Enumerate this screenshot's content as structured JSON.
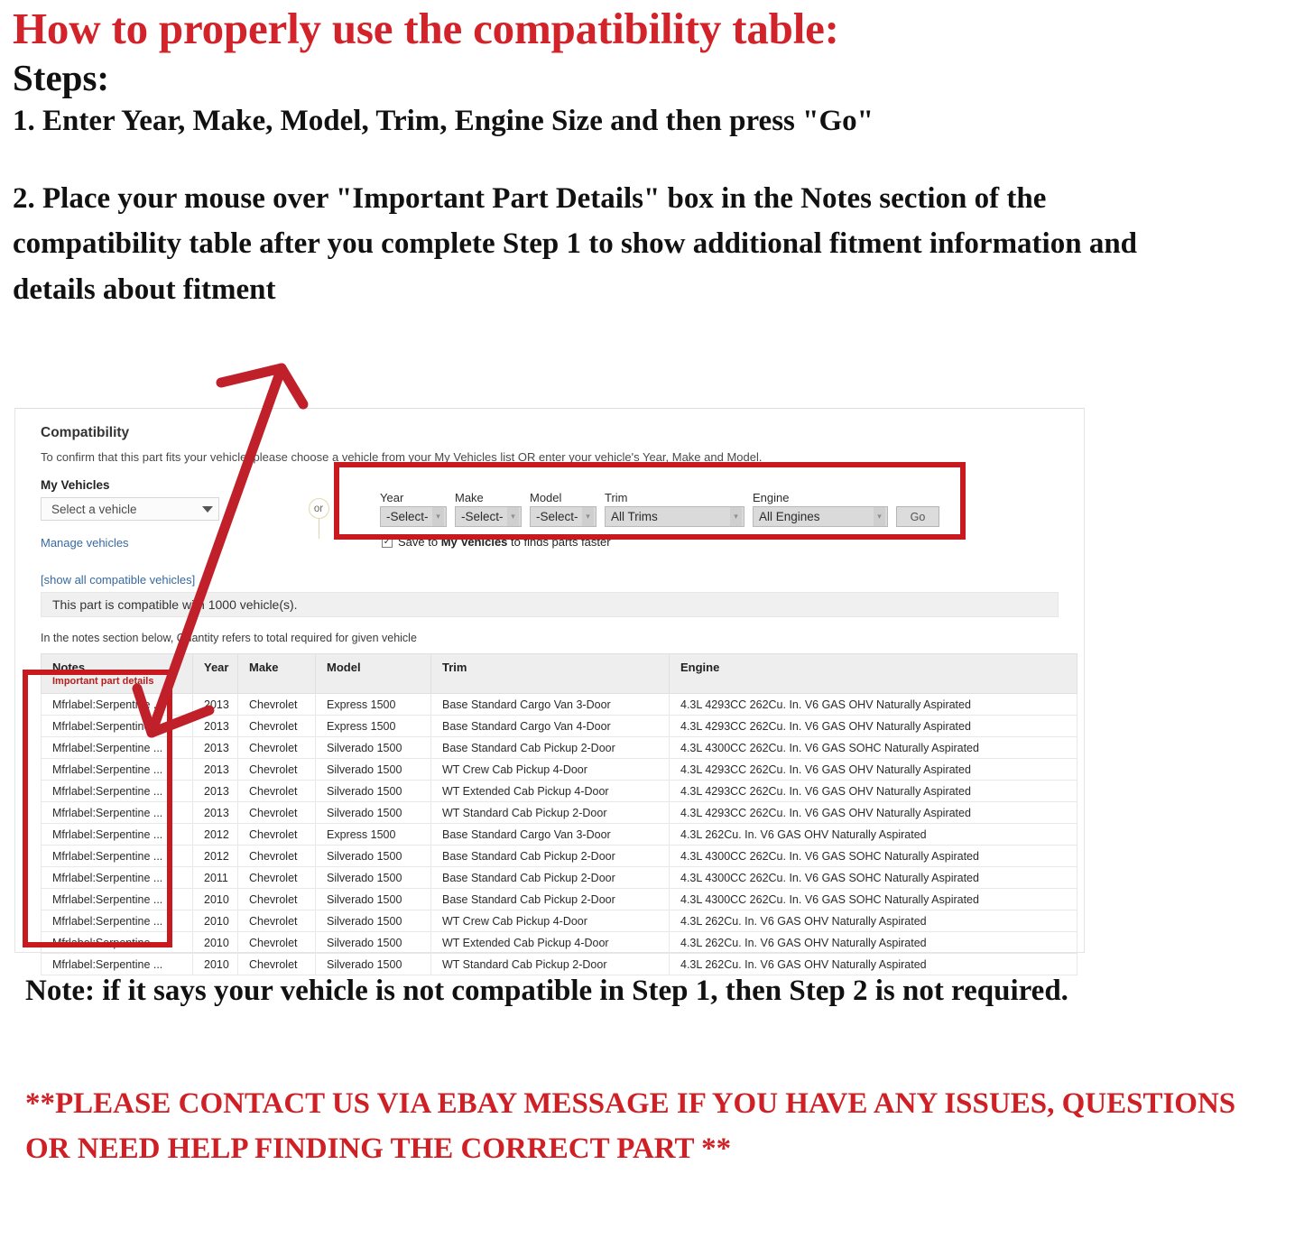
{
  "headings": {
    "title": "How to properly use the compatibility table:",
    "steps_label": "Steps:",
    "step1": "1. Enter Year, Make, Model, Trim, Engine Size and then press \"Go\"",
    "step2": "2. Place your mouse over \"Important Part Details\" box in the Notes section of the compatibility table after you complete Step 1 to show additional fitment information and details about fitment"
  },
  "footer": {
    "note": "Note: if it says your vehicle is not compatible in Step 1, then Step 2 is not required.",
    "contact": "**PLEASE CONTACT US VIA EBAY MESSAGE IF YOU HAVE ANY ISSUES, QUESTIONS OR NEED HELP FINDING THE CORRECT PART **"
  },
  "compatibility": {
    "title": "Compatibility",
    "subtitle": "To confirm that this part fits your vehicle, please choose a vehicle from your My Vehicles list OR enter your vehicle's Year, Make and Model.",
    "my_vehicles_label": "My Vehicles",
    "vehicle_select_value": "Select a vehicle",
    "manage_vehicles_link": "Manage vehicles",
    "show_all_link": "[show all compatible vehicles]",
    "or_label": "or",
    "banner": "This part is compatible with 1000 vehicle(s).",
    "qty_note": "In the notes section below, Quantity refers to total required for given vehicle",
    "fields": [
      {
        "label": "Year",
        "value": "-Select-"
      },
      {
        "label": "Make",
        "value": "-Select-"
      },
      {
        "label": "Model",
        "value": "-Select-"
      },
      {
        "label": "Trim",
        "value": "All Trims"
      },
      {
        "label": "Engine",
        "value": "All Engines"
      }
    ],
    "go_label": "Go",
    "save_checkbox_checked": true,
    "save_text_pre": "Save to ",
    "save_text_bold": "My Vehicles",
    "save_text_post": " to finds parts faster",
    "accent_red": "#c8191e",
    "link_blue": "#3769a0"
  },
  "table": {
    "columns": [
      "Notes",
      "Year",
      "Make",
      "Model",
      "Trim",
      "Engine"
    ],
    "notes_subheader": "Important part details",
    "rows": [
      {
        "notes": "Mfrlabel:Serpentine ...",
        "year": "2013",
        "make": "Chevrolet",
        "model": "Express 1500",
        "trim": "Base Standard Cargo Van 3-Door",
        "engine": "4.3L 4293CC 262Cu. In. V6 GAS OHV Naturally Aspirated"
      },
      {
        "notes": "Mfrlabel:Serpentine ...",
        "year": "2013",
        "make": "Chevrolet",
        "model": "Express 1500",
        "trim": "Base Standard Cargo Van 4-Door",
        "engine": "4.3L 4293CC 262Cu. In. V6 GAS OHV Naturally Aspirated"
      },
      {
        "notes": "Mfrlabel:Serpentine ...",
        "year": "2013",
        "make": "Chevrolet",
        "model": "Silverado 1500",
        "trim": "Base Standard Cab Pickup 2-Door",
        "engine": "4.3L 4300CC 262Cu. In. V6 GAS SOHC Naturally Aspirated"
      },
      {
        "notes": "Mfrlabel:Serpentine ...",
        "year": "2013",
        "make": "Chevrolet",
        "model": "Silverado 1500",
        "trim": "WT Crew Cab Pickup 4-Door",
        "engine": "4.3L 4293CC 262Cu. In. V6 GAS OHV Naturally Aspirated"
      },
      {
        "notes": "Mfrlabel:Serpentine ...",
        "year": "2013",
        "make": "Chevrolet",
        "model": "Silverado 1500",
        "trim": "WT Extended Cab Pickup 4-Door",
        "engine": "4.3L 4293CC 262Cu. In. V6 GAS OHV Naturally Aspirated"
      },
      {
        "notes": "Mfrlabel:Serpentine ...",
        "year": "2013",
        "make": "Chevrolet",
        "model": "Silverado 1500",
        "trim": "WT Standard Cab Pickup 2-Door",
        "engine": "4.3L 4293CC 262Cu. In. V6 GAS OHV Naturally Aspirated"
      },
      {
        "notes": "Mfrlabel:Serpentine ...",
        "year": "2012",
        "make": "Chevrolet",
        "model": "Express 1500",
        "trim": "Base Standard Cargo Van 3-Door",
        "engine": "4.3L 262Cu. In. V6 GAS OHV Naturally Aspirated"
      },
      {
        "notes": "Mfrlabel:Serpentine ...",
        "year": "2012",
        "make": "Chevrolet",
        "model": "Silverado 1500",
        "trim": "Base Standard Cab Pickup 2-Door",
        "engine": "4.3L 4300CC 262Cu. In. V6 GAS SOHC Naturally Aspirated"
      },
      {
        "notes": "Mfrlabel:Serpentine ...",
        "year": "2011",
        "make": "Chevrolet",
        "model": "Silverado 1500",
        "trim": "Base Standard Cab Pickup 2-Door",
        "engine": "4.3L 4300CC 262Cu. In. V6 GAS SOHC Naturally Aspirated"
      },
      {
        "notes": "Mfrlabel:Serpentine ...",
        "year": "2010",
        "make": "Chevrolet",
        "model": "Silverado 1500",
        "trim": "Base Standard Cab Pickup 2-Door",
        "engine": "4.3L 4300CC 262Cu. In. V6 GAS SOHC Naturally Aspirated"
      },
      {
        "notes": "Mfrlabel:Serpentine ...",
        "year": "2010",
        "make": "Chevrolet",
        "model": "Silverado 1500",
        "trim": "WT Crew Cab Pickup 4-Door",
        "engine": "4.3L 262Cu. In. V6 GAS OHV Naturally Aspirated"
      },
      {
        "notes": "Mfrlabel:Serpentine ...",
        "year": "2010",
        "make": "Chevrolet",
        "model": "Silverado 1500",
        "trim": "WT Extended Cab Pickup 4-Door",
        "engine": "4.3L 262Cu. In. V6 GAS OHV Naturally Aspirated"
      },
      {
        "notes": "Mfrlabel:Serpentine ...",
        "year": "2010",
        "make": "Chevrolet",
        "model": "Silverado 1500",
        "trim": "WT Standard Cab Pickup 2-Door",
        "engine": "4.3L 262Cu. In. V6 GAS OHV Naturally Aspirated"
      }
    ]
  }
}
